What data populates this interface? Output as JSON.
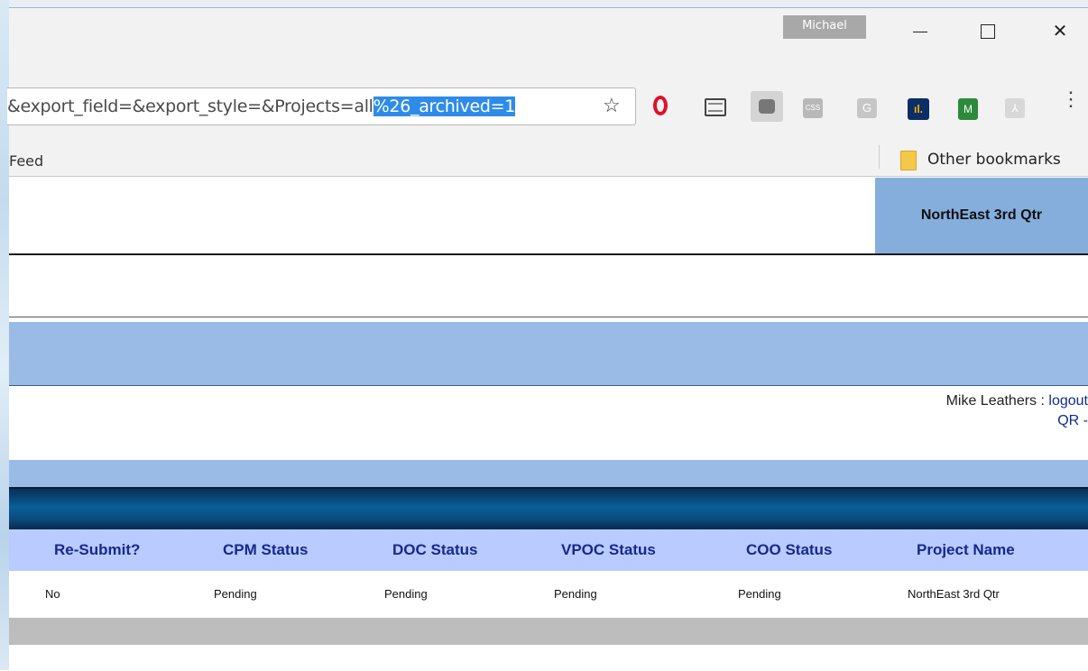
{
  "window": {
    "profile_name": "Michael",
    "minimize_glyph": "",
    "close_glyph": "✕"
  },
  "omnibox": {
    "url_plain": "&export_field=&export_style=&Projects=all",
    "url_selected": "%26_archived=1",
    "star_icon": "☆"
  },
  "extensions": {
    "css_label": "CSS",
    "g_label": "G",
    "bars_label": "ıl.",
    "shield_label": "M",
    "pdf_label": "⅄",
    "menu_glyph": "⋮"
  },
  "bookmarks": {
    "left_item": "Feed",
    "other_label": "Other bookmarks"
  },
  "page": {
    "project_header": "NorthEast 3rd Qtr",
    "user_name": "Mike Leathers :",
    "logout_label": "logout",
    "qr_link": "QR -"
  },
  "table": {
    "columns": [
      "Re-Submit?",
      "CPM Status",
      "DOC Status",
      "VPOC Status",
      "COO Status",
      "Project Name"
    ],
    "rows": [
      [
        "No",
        "Pending",
        "Pending",
        "Pending",
        "Pending",
        "NorthEast 3rd Qtr"
      ]
    ]
  }
}
